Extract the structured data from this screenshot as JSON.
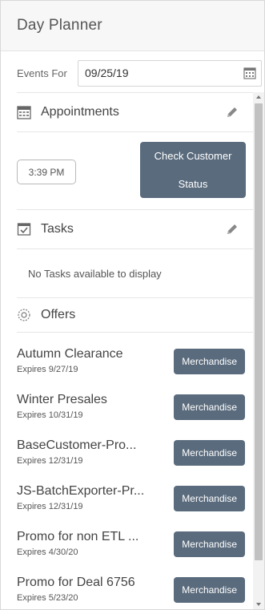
{
  "header": {
    "title": "Day Planner"
  },
  "events_for": {
    "label": "Events For",
    "date_value": "09/25/19",
    "calendar_icon": "calendar-icon"
  },
  "appointments": {
    "label": "Appointments",
    "icon": "calendar-icon",
    "edit_icon": "pencil-icon",
    "time": "3:39 PM",
    "check_button_line1": "Check Customer",
    "check_button_line2": "Status"
  },
  "tasks": {
    "label": "Tasks",
    "icon": "checkbox-icon",
    "edit_icon": "pencil-icon",
    "empty_message": "No Tasks available to display"
  },
  "offers": {
    "label": "Offers",
    "icon": "gear-badge-icon",
    "items": [
      {
        "name": "Autumn Clearance",
        "expires": "Expires 9/27/19",
        "button": "Merchandise"
      },
      {
        "name": "Winter Presales",
        "expires": "Expires 10/31/19",
        "button": "Merchandise"
      },
      {
        "name": "BaseCustomer-Pro...",
        "expires": "Expires 12/31/19",
        "button": "Merchandise"
      },
      {
        "name": "JS-BatchExporter-Pr...",
        "expires": "Expires 12/31/19",
        "button": "Merchandise"
      },
      {
        "name": "Promo for non ETL ...",
        "expires": "Expires 4/30/20",
        "button": "Merchandise"
      },
      {
        "name": "Promo for Deal 6756",
        "expires": "Expires 5/23/20",
        "button": "Merchandise"
      }
    ]
  },
  "colors": {
    "button_bg": "#5a6b7d",
    "header_bg": "#f7f7f7",
    "border": "#e6e6e6"
  }
}
